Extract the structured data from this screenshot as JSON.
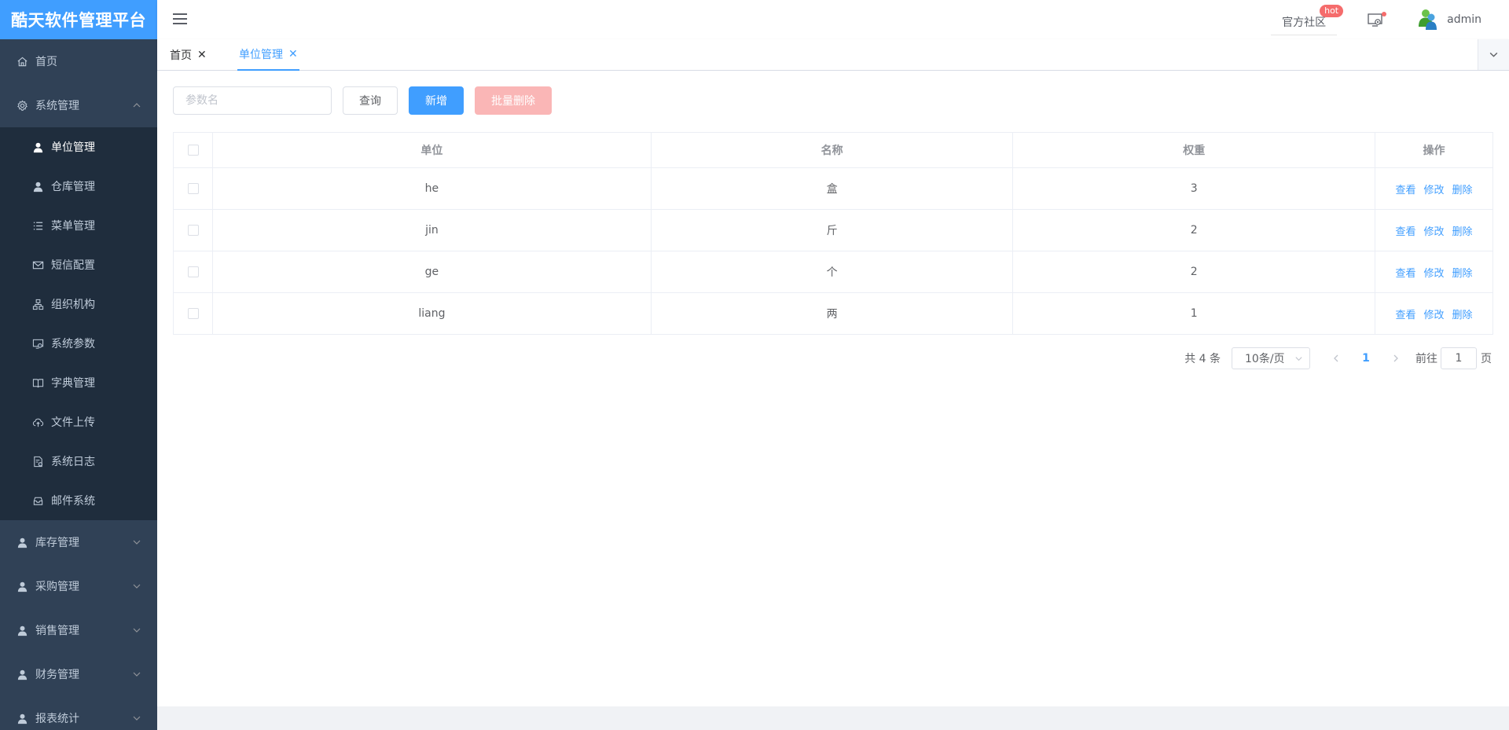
{
  "app": {
    "title": "酷天软件管理平台"
  },
  "header": {
    "community_label": "官方社区",
    "hot_badge": "hot",
    "user_name": "admin"
  },
  "sidebar": {
    "items": [
      {
        "label": "首页",
        "icon": "home-icon"
      },
      {
        "label": "系统管理",
        "icon": "gear-icon",
        "expanded": true,
        "children": [
          {
            "label": "单位管理",
            "icon": "user-icon",
            "active": true
          },
          {
            "label": "仓库管理",
            "icon": "user-icon"
          },
          {
            "label": "菜单管理",
            "icon": "list-icon"
          },
          {
            "label": "短信配置",
            "icon": "mail-icon"
          },
          {
            "label": "组织机构",
            "icon": "org-icon"
          },
          {
            "label": "系统参数",
            "icon": "settings-screen-icon"
          },
          {
            "label": "字典管理",
            "icon": "book-icon"
          },
          {
            "label": "文件上传",
            "icon": "cloud-upload-icon"
          },
          {
            "label": "系统日志",
            "icon": "log-icon"
          },
          {
            "label": "邮件系统",
            "icon": "mailbox-icon"
          }
        ]
      },
      {
        "label": "库存管理",
        "icon": "user-icon"
      },
      {
        "label": "采购管理",
        "icon": "user-icon"
      },
      {
        "label": "销售管理",
        "icon": "user-icon"
      },
      {
        "label": "财务管理",
        "icon": "user-icon"
      },
      {
        "label": "报表统计",
        "icon": "user-icon"
      }
    ]
  },
  "tabs": [
    {
      "label": "首页",
      "close": "✕"
    },
    {
      "label": "单位管理",
      "close": "✕",
      "active": true
    }
  ],
  "toolbar": {
    "search_placeholder": "参数名",
    "search_value": "",
    "query_label": "查询",
    "add_label": "新增",
    "batch_delete_label": "批量删除"
  },
  "table": {
    "columns": [
      "单位",
      "名称",
      "权重",
      "操作"
    ],
    "rows": [
      {
        "unit": "he",
        "name": "盒",
        "weight": "3"
      },
      {
        "unit": "jin",
        "name": "斤",
        "weight": "2"
      },
      {
        "unit": "ge",
        "name": "个",
        "weight": "2"
      },
      {
        "unit": "liang",
        "name": "两",
        "weight": "1"
      }
    ],
    "actions": {
      "view": "查看",
      "edit": "修改",
      "delete": "删除"
    }
  },
  "pagination": {
    "total_text": "共 4 条",
    "page_size": "10条/页",
    "current_page": "1",
    "goto_label": "前往",
    "goto_value": "1",
    "page_suffix": "页"
  },
  "colors": {
    "sidebar_bg": "#304156",
    "submenu_bg": "#1f2d3d",
    "primary": "#409eff",
    "danger_disabled": "#fab6b6",
    "badge": "#f56c6c"
  }
}
